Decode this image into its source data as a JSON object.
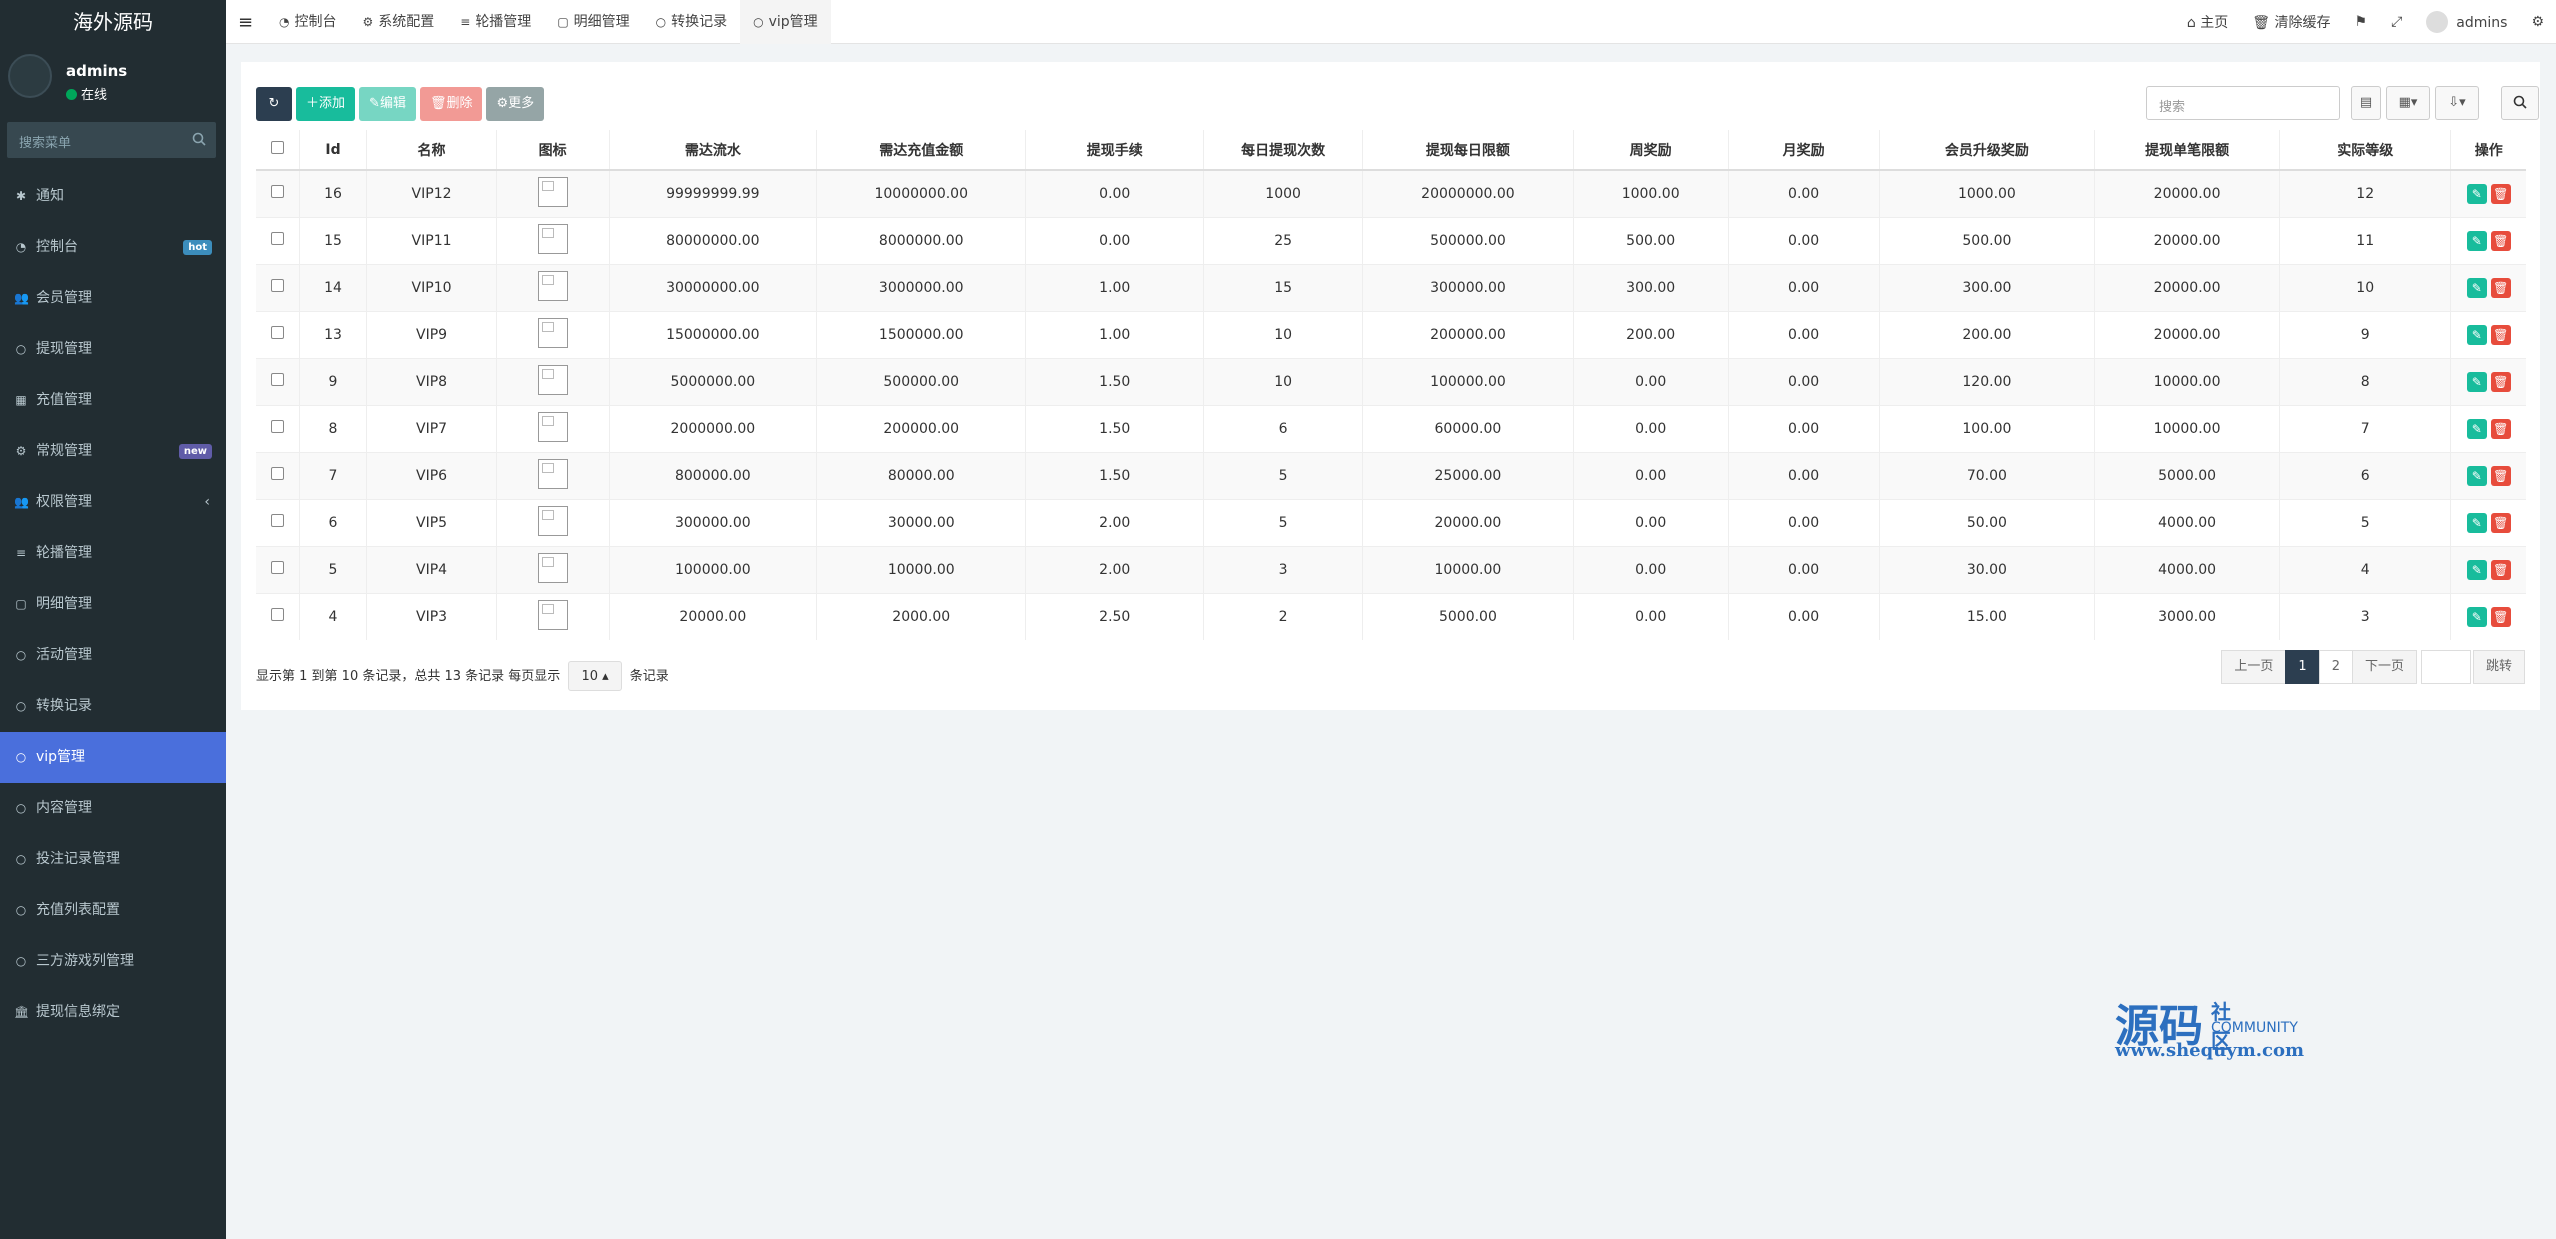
{
  "app": {
    "title": "海外源码"
  },
  "user": {
    "name": "admins",
    "status": "在线"
  },
  "sidebar": {
    "search_placeholder": "搜索菜单",
    "items": [
      {
        "label": "通知",
        "icon": "✱"
      },
      {
        "label": "控制台",
        "icon": "◔",
        "badge": "hot",
        "badge_color": "#3c8dbc"
      },
      {
        "label": "会员管理",
        "icon": "👥"
      },
      {
        "label": "提现管理",
        "icon": "○"
      },
      {
        "label": "充值管理",
        "icon": "▦"
      },
      {
        "label": "常规管理",
        "icon": "⚙",
        "badge": "new",
        "badge_color": "#605ca8"
      },
      {
        "label": "权限管理",
        "icon": "👥",
        "chevron": "‹"
      },
      {
        "label": "轮播管理",
        "icon": "≡"
      },
      {
        "label": "明细管理",
        "icon": "▢"
      },
      {
        "label": "活动管理",
        "icon": "○"
      },
      {
        "label": "转换记录",
        "icon": "○"
      },
      {
        "label": "vip管理",
        "icon": "○",
        "active": true
      },
      {
        "label": "内容管理",
        "icon": "○"
      },
      {
        "label": "投注记录管理",
        "icon": "○"
      },
      {
        "label": "充值列表配置",
        "icon": "○"
      },
      {
        "label": "三方游戏列管理",
        "icon": "○"
      },
      {
        "label": "提现信息绑定",
        "icon": "🏛"
      }
    ]
  },
  "topbar": {
    "tabs": [
      {
        "label": "控制台",
        "icon": "◔"
      },
      {
        "label": "系统配置",
        "icon": "⚙"
      },
      {
        "label": "轮播管理",
        "icon": "≡"
      },
      {
        "label": "明细管理",
        "icon": "▢"
      },
      {
        "label": "转换记录",
        "icon": "○"
      },
      {
        "label": "vip管理",
        "icon": "○",
        "active": true
      }
    ],
    "home": "主页",
    "clear_cache": "清除缓存",
    "user": "admins"
  },
  "toolbar": {
    "add": "添加",
    "edit": "编辑",
    "delete": "删除",
    "more": "更多",
    "search_placeholder": "搜索"
  },
  "table": {
    "headers": [
      "Id",
      "名称",
      "图标",
      "需达流水",
      "需达充值金额",
      "提现手续",
      "每日提现次数",
      "提现每日限额",
      "周奖励",
      "月奖励",
      "会员升级奖励",
      "提现单笔限额",
      "实际等级",
      "操作"
    ],
    "rows": [
      [
        "16",
        "VIP12",
        "99999999.99",
        "10000000.00",
        "0.00",
        "1000",
        "20000000.00",
        "1000.00",
        "0.00",
        "1000.00",
        "20000.00",
        "12"
      ],
      [
        "15",
        "VIP11",
        "80000000.00",
        "8000000.00",
        "0.00",
        "25",
        "500000.00",
        "500.00",
        "0.00",
        "500.00",
        "20000.00",
        "11"
      ],
      [
        "14",
        "VIP10",
        "30000000.00",
        "3000000.00",
        "1.00",
        "15",
        "300000.00",
        "300.00",
        "0.00",
        "300.00",
        "20000.00",
        "10"
      ],
      [
        "13",
        "VIP9",
        "15000000.00",
        "1500000.00",
        "1.00",
        "10",
        "200000.00",
        "200.00",
        "0.00",
        "200.00",
        "20000.00",
        "9"
      ],
      [
        "9",
        "VIP8",
        "5000000.00",
        "500000.00",
        "1.50",
        "10",
        "100000.00",
        "0.00",
        "0.00",
        "120.00",
        "10000.00",
        "8"
      ],
      [
        "8",
        "VIP7",
        "2000000.00",
        "200000.00",
        "1.50",
        "6",
        "60000.00",
        "0.00",
        "0.00",
        "100.00",
        "10000.00",
        "7"
      ],
      [
        "7",
        "VIP6",
        "800000.00",
        "80000.00",
        "1.50",
        "5",
        "25000.00",
        "0.00",
        "0.00",
        "70.00",
        "5000.00",
        "6"
      ],
      [
        "6",
        "VIP5",
        "300000.00",
        "30000.00",
        "2.00",
        "5",
        "20000.00",
        "0.00",
        "0.00",
        "50.00",
        "4000.00",
        "5"
      ],
      [
        "5",
        "VIP4",
        "100000.00",
        "10000.00",
        "2.00",
        "3",
        "10000.00",
        "0.00",
        "0.00",
        "30.00",
        "4000.00",
        "4"
      ],
      [
        "4",
        "VIP3",
        "20000.00",
        "2000.00",
        "2.50",
        "2",
        "5000.00",
        "0.00",
        "0.00",
        "15.00",
        "3000.00",
        "3"
      ]
    ]
  },
  "pagination": {
    "info_prefix": "显示第 1 到第 10 条记录，总共 13 条记录 每页显示",
    "page_size": "10",
    "info_suffix": "条记录",
    "prev": "上一页",
    "pages": [
      "1",
      "2"
    ],
    "next": "下一页",
    "jump": "跳转"
  },
  "watermark": {
    "big": "源码",
    "small": "社区",
    "community": "COMMUNITY",
    "url": "www.shequym.com"
  }
}
